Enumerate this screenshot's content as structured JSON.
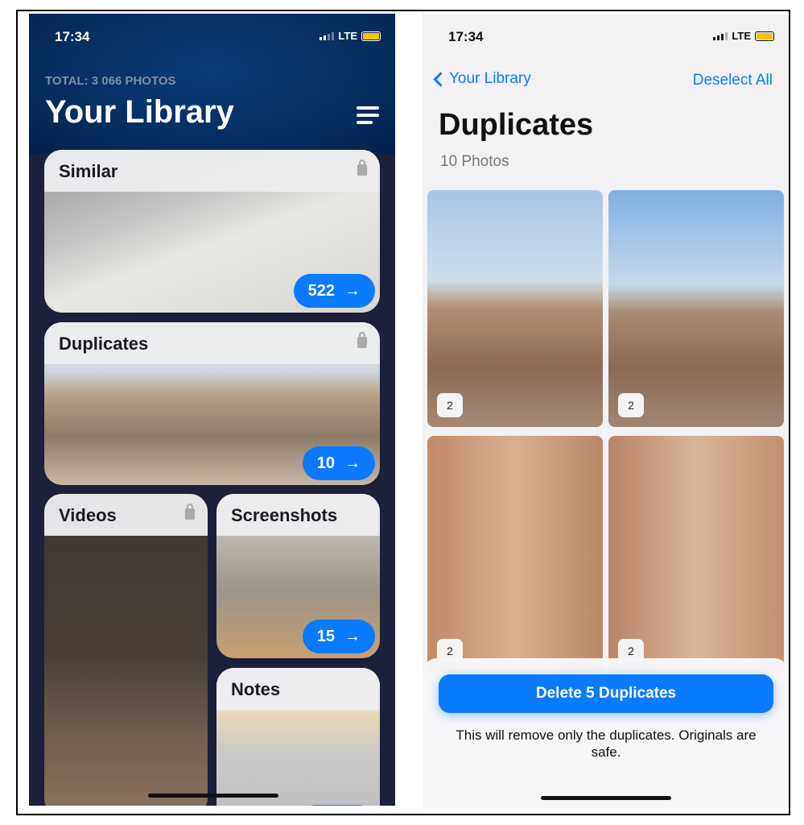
{
  "left": {
    "status": {
      "time": "17:34",
      "network": "LTE"
    },
    "total": "TOTAL: 3 066 PHOTOS",
    "title": "Your Library",
    "cards": [
      {
        "title": "Similar",
        "count": "522",
        "locked": true
      },
      {
        "title": "Duplicates",
        "count": "10",
        "locked": true
      },
      {
        "title": "Videos",
        "locked": true
      },
      {
        "title": "Screenshots",
        "count": "15"
      },
      {
        "title": "Notes"
      }
    ],
    "arrow": "→"
  },
  "right": {
    "status": {
      "time": "17:34",
      "network": "LTE"
    },
    "back_label": "Your Library",
    "deselect_label": "Deselect All",
    "title": "Duplicates",
    "subtitle": "10 Photos",
    "photos": [
      {
        "badge": "2"
      },
      {
        "badge": "2"
      },
      {
        "badge": "2"
      },
      {
        "badge": "2"
      }
    ],
    "delete_label": "Delete 5 Duplicates",
    "note": "This will remove only the duplicates. Originals are safe."
  },
  "colors": {
    "accent": "#0a7bff",
    "battery": "#f7c600"
  }
}
